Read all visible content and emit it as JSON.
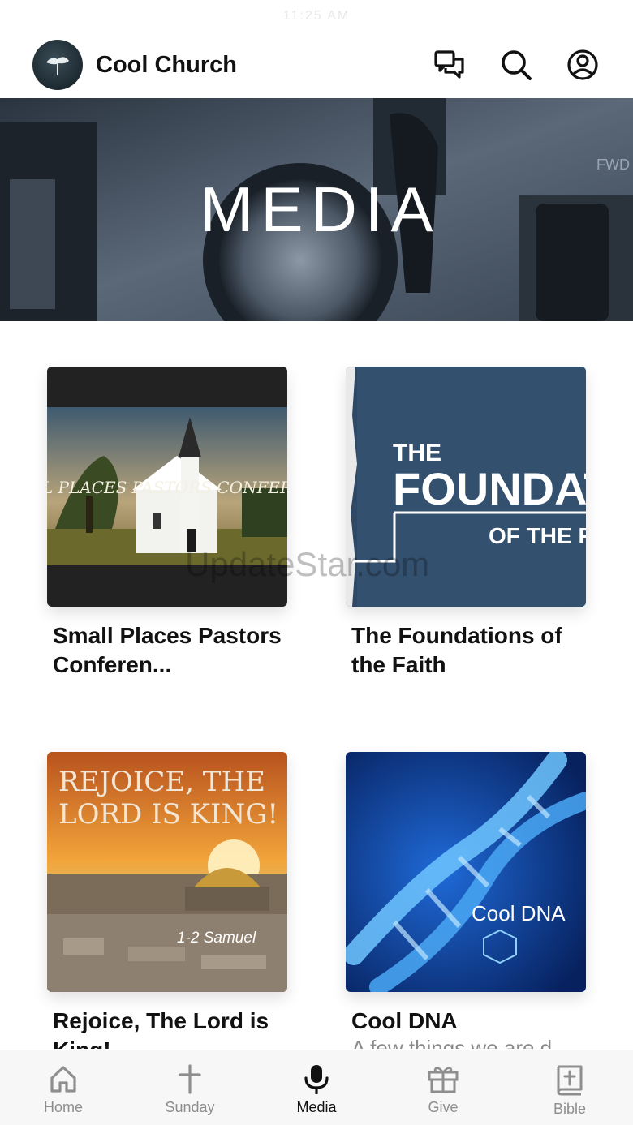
{
  "status_bar": {
    "time": "11:25 AM"
  },
  "header": {
    "title": "Cool Church"
  },
  "hero": {
    "title": "MEDIA"
  },
  "watermark": "UpdateStar.com",
  "cards": [
    {
      "title": "Small Places Pastors Conferen...",
      "image_text": "SMALL PLACES PASTORS CONFERENCE"
    },
    {
      "title": "The Foundations of the Faith",
      "image_text_1": "THE",
      "image_text_2": "FOUNDATIO",
      "image_text_3": "OF THE FA"
    },
    {
      "title": "Rejoice, The Lord is King!",
      "image_text_1": "REJOICE, THE",
      "image_text_2": "LORD IS KING!",
      "image_text_3": "1-2 Samuel"
    },
    {
      "title": "Cool DNA",
      "subtitle": "A few things we are d...",
      "image_text": "Cool DNA"
    }
  ],
  "tabs": [
    {
      "label": "Home",
      "icon": "home-icon"
    },
    {
      "label": "Sunday",
      "icon": "cross-icon"
    },
    {
      "label": "Media",
      "icon": "microphone-icon",
      "active": true
    },
    {
      "label": "Give",
      "icon": "gift-icon"
    },
    {
      "label": "Bible",
      "icon": "bible-icon"
    }
  ],
  "colors": {
    "active_tab": "#111111",
    "inactive_tab": "#8e8e8e",
    "tab_bar_bg": "#f7f7f7"
  }
}
